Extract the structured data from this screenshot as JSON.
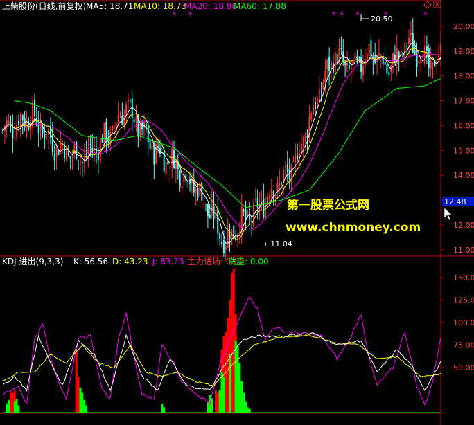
{
  "header": {
    "stock": "上柴股份(日线,前复权)",
    "ma5": "MA5: 18.71",
    "ma10": "MA10: 18.73",
    "ma20": "MA20: 18.86",
    "ma60": "MA60: 17.88"
  },
  "sub_header": {
    "name": "KDJ-进出(9,3,3)",
    "k": "K: 56.56",
    "d": "D: 43.23",
    "j": "J: 83.23",
    "main": "主力进场: 0.00",
    "wash": "洗盘: 0.00"
  },
  "watermark": {
    "cn": "第一股票公式网",
    "url": "www.chnmoney.com"
  },
  "annotations": {
    "high_label": "20.50",
    "low_label": "←11.04",
    "price_tag": "12.48"
  },
  "colors": {
    "up": "#ff3232",
    "down": "#54ffff",
    "ma5": "#ffffff",
    "ma10": "#ffff00",
    "ma20": "#ff00ff",
    "ma60": "#00ff00",
    "axis": "#c00000",
    "label": "#ff5050",
    "main_bar": "#ff0000",
    "wash_bar": "#00ff00"
  },
  "chart_data": [
    {
      "type": "candlestick",
      "ylim": [
        10.8,
        20.5
      ],
      "yticks": [
        "20.00",
        "19.00",
        "18.00",
        "17.00",
        "16.00",
        "15.00",
        "14.00",
        "13.00",
        "12.00",
        "11.00"
      ],
      "ytick_values": [
        20,
        19,
        18,
        17,
        16,
        15,
        14,
        13,
        12,
        11
      ],
      "trend": [
        [
          0,
          15.8
        ],
        [
          14,
          16.4
        ],
        [
          28,
          15.1
        ],
        [
          40,
          14.7
        ],
        [
          48,
          15.2
        ],
        [
          56,
          15.9
        ],
        [
          62,
          16.8
        ],
        [
          68,
          16.0
        ],
        [
          76,
          15.0
        ],
        [
          86,
          14.5
        ],
        [
          98,
          13.4
        ],
        [
          108,
          11.9
        ],
        [
          112,
          11.3
        ],
        [
          118,
          12.0
        ],
        [
          126,
          12.4
        ],
        [
          134,
          13.3
        ],
        [
          146,
          14.3
        ],
        [
          156,
          16.7
        ],
        [
          166,
          18.8
        ],
        [
          176,
          18.2
        ],
        [
          184,
          19.0
        ],
        [
          194,
          18.3
        ],
        [
          204,
          19.3
        ],
        [
          210,
          18.9
        ],
        [
          216,
          18.3
        ],
        [
          220,
          19.0
        ]
      ],
      "ma60": [
        [
          6,
          17.0
        ],
        [
          14,
          16.9
        ],
        [
          24,
          16.6
        ],
        [
          40,
          15.6
        ],
        [
          56,
          15.4
        ],
        [
          68,
          15.6
        ],
        [
          86,
          15.1
        ],
        [
          100,
          14.2
        ],
        [
          110,
          13.6
        ],
        [
          122,
          12.7
        ],
        [
          140,
          13.0
        ],
        [
          154,
          13.4
        ],
        [
          168,
          14.8
        ],
        [
          182,
          16.6
        ],
        [
          198,
          17.5
        ],
        [
          212,
          17.6
        ],
        [
          220,
          17.9
        ]
      ],
      "extremes": {
        "high": 20.5,
        "low": 11.04
      },
      "last_price": 12.48,
      "markers_x": [
        86,
        94,
        166,
        170,
        178,
        192,
        212
      ]
    },
    {
      "type": "line+bar",
      "ylim": [
        0,
        160
      ],
      "yticks": [
        "150.00",
        "125.00",
        "100.00",
        "75.00",
        "50.00"
      ],
      "ytick_values": [
        150,
        125,
        100,
        75,
        50
      ],
      "j": [
        [
          0,
          20
        ],
        [
          4,
          25
        ],
        [
          8,
          28
        ],
        [
          12,
          10
        ],
        [
          16,
          80
        ],
        [
          20,
          100
        ],
        [
          24,
          60
        ],
        [
          28,
          35
        ],
        [
          32,
          15
        ],
        [
          38,
          82
        ],
        [
          44,
          85
        ],
        [
          50,
          25
        ],
        [
          54,
          15
        ],
        [
          58,
          80
        ],
        [
          62,
          110
        ],
        [
          66,
          60
        ],
        [
          70,
          20
        ],
        [
          76,
          15
        ],
        [
          80,
          75
        ],
        [
          86,
          55
        ],
        [
          90,
          35
        ],
        [
          98,
          20
        ],
        [
          104,
          10
        ],
        [
          110,
          60
        ],
        [
          118,
          100
        ],
        [
          124,
          130
        ],
        [
          128,
          115
        ],
        [
          132,
          80
        ],
        [
          136,
          95
        ],
        [
          142,
          90
        ],
        [
          150,
          88
        ],
        [
          160,
          85
        ],
        [
          168,
          60
        ],
        [
          174,
          80
        ],
        [
          180,
          110
        ],
        [
          184,
          60
        ],
        [
          188,
          30
        ],
        [
          196,
          50
        ],
        [
          202,
          90
        ],
        [
          208,
          30
        ],
        [
          212,
          8
        ],
        [
          216,
          35
        ],
        [
          220,
          85
        ]
      ],
      "k": [
        [
          0,
          30
        ],
        [
          6,
          40
        ],
        [
          12,
          25
        ],
        [
          18,
          85
        ],
        [
          24,
          55
        ],
        [
          30,
          30
        ],
        [
          38,
          80
        ],
        [
          46,
          65
        ],
        [
          54,
          25
        ],
        [
          62,
          85
        ],
        [
          70,
          40
        ],
        [
          78,
          25
        ],
        [
          84,
          60
        ],
        [
          92,
          30
        ],
        [
          104,
          25
        ],
        [
          112,
          55
        ],
        [
          120,
          80
        ],
        [
          128,
          85
        ],
        [
          140,
          85
        ],
        [
          156,
          88
        ],
        [
          168,
          75
        ],
        [
          180,
          80
        ],
        [
          188,
          45
        ],
        [
          198,
          70
        ],
        [
          206,
          50
        ],
        [
          212,
          25
        ],
        [
          220,
          56
        ]
      ],
      "d": [
        [
          0,
          35
        ],
        [
          8,
          45
        ],
        [
          16,
          45
        ],
        [
          24,
          65
        ],
        [
          32,
          55
        ],
        [
          40,
          75
        ],
        [
          48,
          55
        ],
        [
          56,
          50
        ],
        [
          64,
          75
        ],
        [
          72,
          45
        ],
        [
          80,
          40
        ],
        [
          88,
          45
        ],
        [
          96,
          35
        ],
        [
          106,
          30
        ],
        [
          116,
          55
        ],
        [
          126,
          75
        ],
        [
          138,
          83
        ],
        [
          154,
          86
        ],
        [
          166,
          78
        ],
        [
          178,
          76
        ],
        [
          188,
          60
        ],
        [
          198,
          62
        ],
        [
          210,
          40
        ],
        [
          220,
          43
        ]
      ],
      "main_entry": [
        [
          4,
          22
        ],
        [
          5,
          22
        ],
        [
          6,
          25
        ],
        [
          7,
          12
        ],
        [
          37,
          70
        ],
        [
          38,
          40
        ],
        [
          39,
          20
        ],
        [
          107,
          25
        ],
        [
          108,
          22
        ],
        [
          110,
          70
        ],
        [
          111,
          85
        ],
        [
          112,
          90
        ],
        [
          113,
          105
        ],
        [
          114,
          125
        ],
        [
          115,
          155
        ],
        [
          116,
          160
        ],
        [
          117,
          110
        ],
        [
          118,
          70
        ],
        [
          119,
          40
        ],
        [
          120,
          20
        ]
      ],
      "wash": [
        [
          2,
          10
        ],
        [
          3,
          14
        ],
        [
          6,
          12
        ],
        [
          7,
          15
        ],
        [
          8,
          8
        ],
        [
          39,
          28
        ],
        [
          40,
          22
        ],
        [
          41,
          14
        ],
        [
          42,
          8
        ],
        [
          80,
          10
        ],
        [
          81,
          6
        ],
        [
          103,
          12
        ],
        [
          104,
          20
        ],
        [
          105,
          16
        ],
        [
          109,
          25
        ],
        [
          110,
          45
        ],
        [
          111,
          40
        ],
        [
          114,
          65
        ],
        [
          117,
          80
        ],
        [
          118,
          75
        ],
        [
          119,
          55
        ],
        [
          120,
          35
        ],
        [
          121,
          22
        ],
        [
          122,
          12
        ],
        [
          123,
          6
        ],
        [
          124,
          4
        ]
      ]
    }
  ]
}
